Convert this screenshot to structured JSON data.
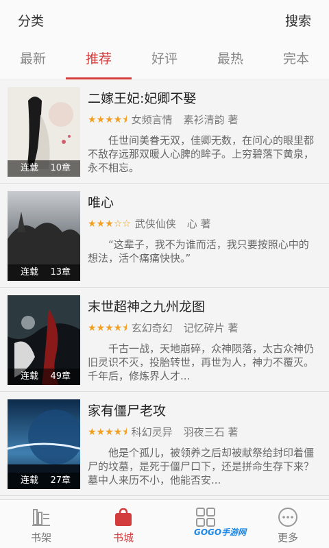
{
  "header": {
    "left_label": "分类",
    "right_label": "搜索"
  },
  "tabs": [
    "最新",
    "推荐",
    "好评",
    "最热",
    "完本"
  ],
  "active_tab_index": 1,
  "books": [
    {
      "title": "二嫁王妃:妃卿不娶",
      "rating": 4.5,
      "stars_text": "★★★★⯨",
      "category": "女频言情",
      "author": "素衫清韵 著",
      "description": "任世间美眷无双，佳卿无数，在问心的眼里都不敌存远那双暖人心脾的眸子。上穷碧落下黄泉，永不相忘。",
      "status": "连载",
      "chapters": "10章"
    },
    {
      "title": "唯心",
      "rating": 3,
      "stars_text": "★★★☆☆",
      "category": "武侠仙侠",
      "author": "心 著",
      "description": "“这辈子，我不为谁而活，我只要按照心中的想法，活个痛痛快快。”",
      "status": "连载",
      "chapters": "13章"
    },
    {
      "title": "末世超神之九州龙图",
      "rating": 4.5,
      "stars_text": "★★★★⯨",
      "category": "玄幻奇幻",
      "author": "记忆碎片 著",
      "description": "千古一战，天地崩碎，众神陨落，太古众神仍旧灵识不灭，投胎转世，再世为人，神力不覆灭。     千年后，修炼界人才...",
      "status": "连载",
      "chapters": "49章"
    },
    {
      "title": "家有僵尸老攻",
      "rating": 4.5,
      "stars_text": "★★★★⯨",
      "category": "科幻灵异",
      "author": "羽夜三石 著",
      "description": "他是个孤儿，被领养之后却被献祭给封印着僵尸的坟墓，是死于僵尸口下，还是拼命生存下来？墓中人来历不小，他能否安...",
      "status": "连载",
      "chapters": "27章"
    }
  ],
  "bottom_nav": [
    {
      "label": "书架",
      "icon": "bookshelf-icon"
    },
    {
      "label": "书城",
      "icon": "bookstore-bag-icon"
    },
    {
      "label": "",
      "icon": "grid-icon"
    },
    {
      "label": "更多",
      "icon": "more-dots-icon"
    }
  ],
  "active_nav_index": 1,
  "watermark": "GOGO手游网",
  "colors": {
    "accent": "#d23c3c",
    "star": "#f0a020"
  }
}
